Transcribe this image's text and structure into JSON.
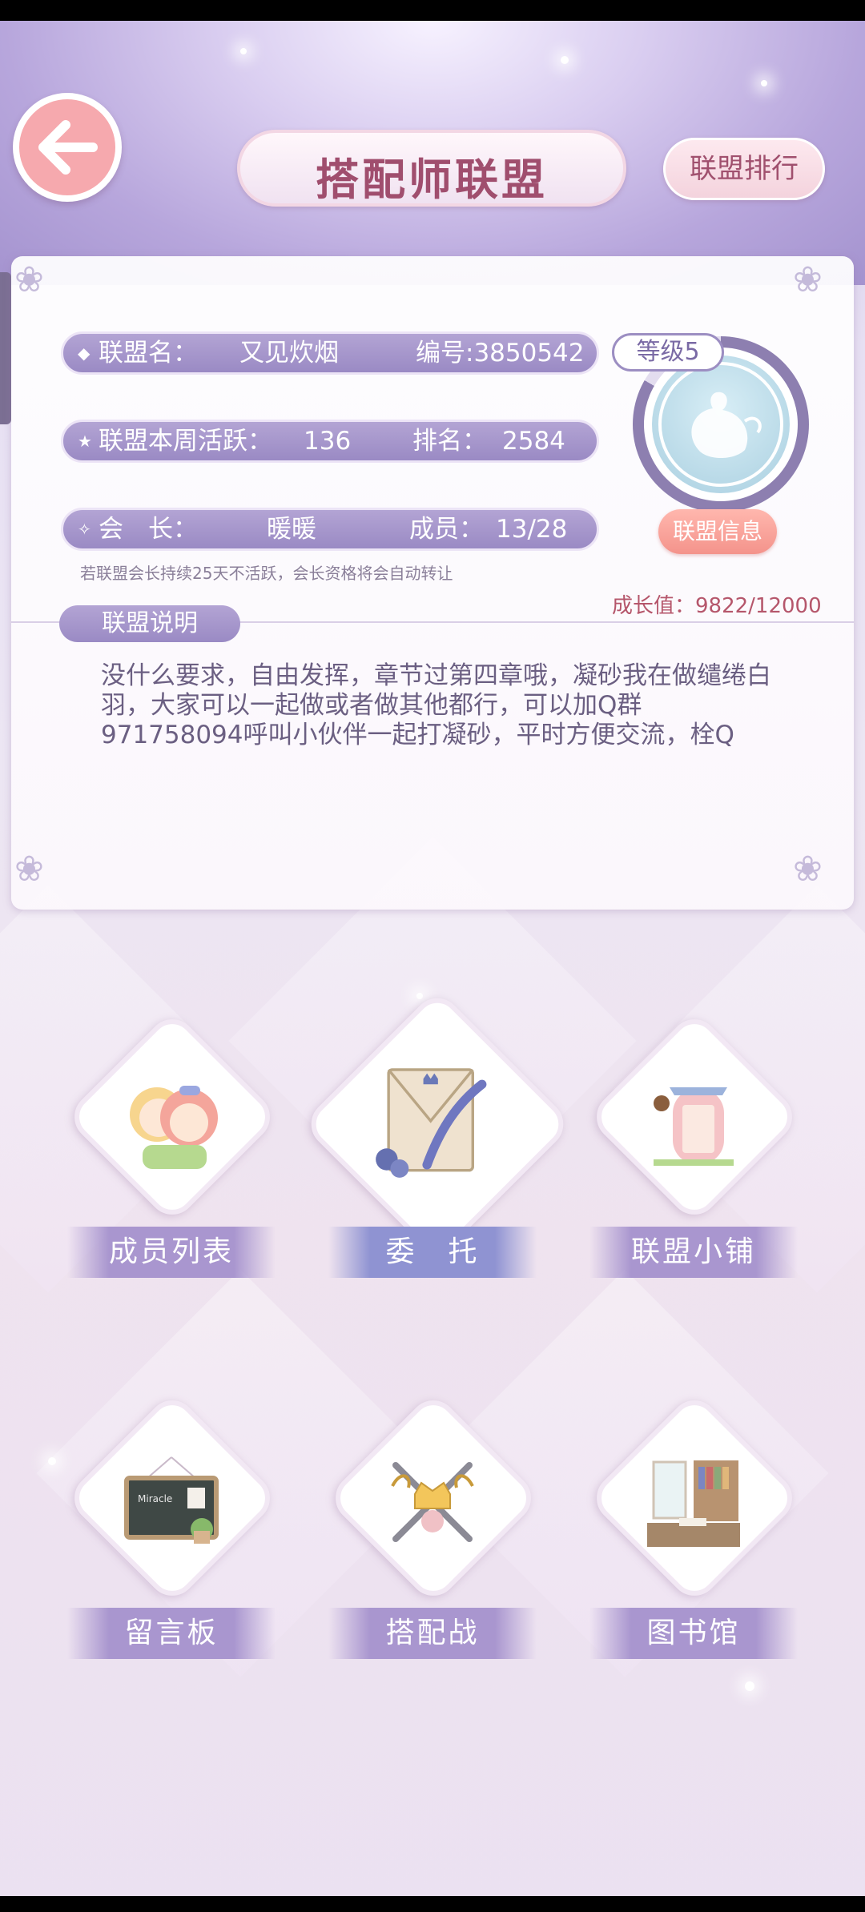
{
  "header": {
    "title": "搭配师联盟",
    "rank_button": "联盟排行"
  },
  "info": {
    "alliance_name_label": "联盟名：",
    "alliance_name": "又见炊烟",
    "id_text": "编号:3850542",
    "weekly_active_label": "联盟本周活跃：",
    "weekly_active_value": "136",
    "rank_label": "排名：",
    "rank_value": "2584",
    "leader_label": "会　长：",
    "leader_value": "暖暖",
    "members_label": "成员：",
    "members_value": "13/28",
    "level": "等级5",
    "info_button": "联盟信息",
    "notice": "若联盟会长持续25天不活跃，会长资格将会自动转让",
    "growth": "成长值：9822/12000"
  },
  "description": {
    "tag": "联盟说明",
    "text": "没什么要求，自由发挥，章节过第四章哦，凝砂我在做缱绻白羽，大家可以一起做或者做其他都行，可以加Q群971758094呼叫小伙伴一起打凝砂，平时方便交流，栓Q"
  },
  "features": [
    {
      "label": "成员列表",
      "icon": "members-icon"
    },
    {
      "label": "委　托",
      "icon": "commission-icon"
    },
    {
      "label": "联盟小铺",
      "icon": "shop-icon"
    },
    {
      "label": "留言板",
      "icon": "message-board-icon"
    },
    {
      "label": "搭配战",
      "icon": "battle-icon"
    },
    {
      "label": "图书馆",
      "icon": "library-icon"
    }
  ],
  "colors": {
    "accent": "#a996cf",
    "title": "#a04e6e",
    "back_button": "#f6a9ae"
  }
}
